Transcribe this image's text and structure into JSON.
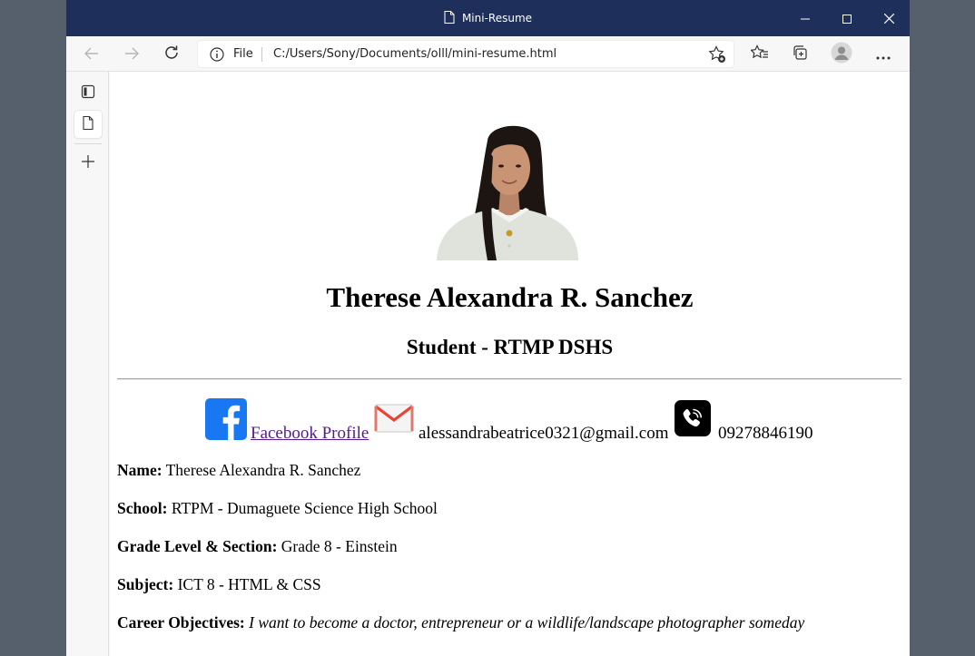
{
  "window": {
    "title": "Mini-Resume"
  },
  "address_bar": {
    "scheme_label": "File",
    "url": "C:/Users/Sony/Documents/olll/mini-resume.html"
  },
  "colors": {
    "titlebar": "#1f2f5c",
    "facebook": "#1877f2",
    "link_visited": "#551a8b",
    "gmail_red": "#ea4335"
  },
  "icons": {
    "document": "document-icon",
    "minimize": "minimize-icon",
    "maximize": "maximize-icon",
    "close": "close-icon",
    "back": "back-arrow-icon",
    "forward": "forward-arrow-icon",
    "refresh": "refresh-icon",
    "info": "info-icon",
    "favorite_add": "favorite-add-icon",
    "favorites": "favorites-icon",
    "collections": "collections-icon",
    "profile": "profile-icon",
    "more": "more-icon",
    "tab_actions": "tab-actions-icon",
    "new_tab": "new-tab-icon",
    "facebook": "facebook-icon",
    "gmail": "gmail-icon",
    "viber": "viber-phone-icon"
  },
  "resume": {
    "name": "Therese Alexandra R. Sanchez",
    "role": "Student - RTMP DSHS",
    "contact": {
      "facebook_label": "Facebook Profile ",
      "email": "alessandrabeatrice0321@gmail.com",
      "phone": "09278846190"
    },
    "details": [
      {
        "label": "Name:",
        "value": " Therese Alexandra R. Sanchez"
      },
      {
        "label": "School:",
        "value": " RTPM - Dumaguete Science High School"
      },
      {
        "label": "Grade Level & Section:",
        "value": " Grade 8 - Einstein"
      },
      {
        "label": "Subject:",
        "value": " ICT 8 - HTML & CSS"
      },
      {
        "label": "Career Objectives:",
        "value": "I want to become a doctor, entrepreneur or a wildlife/landscape photographer someday"
      }
    ]
  }
}
